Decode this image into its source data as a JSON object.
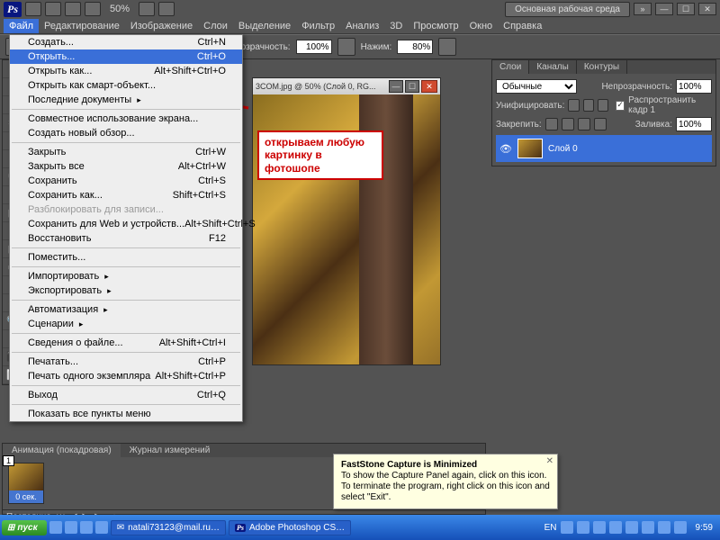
{
  "app_badge": "Ps",
  "zoom_title": "50%",
  "workspace_label": "Основная рабочая среда",
  "menubar": [
    "Файл",
    "Редактирование",
    "Изображение",
    "Слои",
    "Выделение",
    "Фильтр",
    "Анализ",
    "3D",
    "Просмотр",
    "Окно",
    "Справка"
  ],
  "options": {
    "label1": "Непрозрачность:",
    "val1": "100%",
    "label2": "Нажим:",
    "val2": "80%"
  },
  "file_menu": [
    {
      "label": "Создать...",
      "short": "Ctrl+N",
      "type": "i"
    },
    {
      "label": "Открыть...",
      "short": "Ctrl+O",
      "type": "hover"
    },
    {
      "label": "Открыть как...",
      "short": "Alt+Shift+Ctrl+O",
      "type": "i"
    },
    {
      "label": "Открыть как смарт-объект...",
      "short": "",
      "type": "i"
    },
    {
      "label": "Последние документы",
      "short": "",
      "type": "sub"
    },
    {
      "type": "sep"
    },
    {
      "label": "Совместное использование экрана...",
      "short": "",
      "type": "i"
    },
    {
      "label": "Создать новый обзор...",
      "short": "",
      "type": "i"
    },
    {
      "type": "sep"
    },
    {
      "label": "Закрыть",
      "short": "Ctrl+W",
      "type": "i"
    },
    {
      "label": "Закрыть все",
      "short": "Alt+Ctrl+W",
      "type": "i"
    },
    {
      "label": "Сохранить",
      "short": "Ctrl+S",
      "type": "i"
    },
    {
      "label": "Сохранить как...",
      "short": "Shift+Ctrl+S",
      "type": "i"
    },
    {
      "label": "Разблокировать для записи...",
      "short": "",
      "type": "disabled"
    },
    {
      "label": "Сохранить для Web и устройств...",
      "short": "Alt+Shift+Ctrl+S",
      "type": "i"
    },
    {
      "label": "Восстановить",
      "short": "F12",
      "type": "i"
    },
    {
      "type": "sep"
    },
    {
      "label": "Поместить...",
      "short": "",
      "type": "i"
    },
    {
      "type": "sep"
    },
    {
      "label": "Импортировать",
      "short": "",
      "type": "sub"
    },
    {
      "label": "Экспортировать",
      "short": "",
      "type": "sub"
    },
    {
      "type": "sep"
    },
    {
      "label": "Автоматизация",
      "short": "",
      "type": "sub"
    },
    {
      "label": "Сценарии",
      "short": "",
      "type": "sub"
    },
    {
      "type": "sep"
    },
    {
      "label": "Сведения о файле...",
      "short": "Alt+Shift+Ctrl+I",
      "type": "i"
    },
    {
      "type": "sep"
    },
    {
      "label": "Печатать...",
      "short": "Ctrl+P",
      "type": "i"
    },
    {
      "label": "Печать одного экземпляра",
      "short": "Alt+Shift+Ctrl+P",
      "type": "i"
    },
    {
      "type": "sep"
    },
    {
      "label": "Выход",
      "short": "Ctrl+Q",
      "type": "i"
    },
    {
      "type": "sep"
    },
    {
      "label": "Показать все пункты меню",
      "short": "",
      "type": "i"
    }
  ],
  "doc_title": "3COM.jpg @ 50% (Слой 0, RG...",
  "annotation": "открываем любую картинку в фотошопе",
  "layers_tabs": [
    "Слои",
    "Каналы",
    "Контуры"
  ],
  "layers": {
    "mode": "Обычные",
    "opacity_label": "Непрозрачность:",
    "opacity": "100%",
    "unify": "Унифицировать:",
    "propagate": "Распространить кадр 1",
    "lock": "Закрепить:",
    "fill_label": "Заливка:",
    "fill": "100%",
    "layer_name": "Слой 0"
  },
  "anim_tabs": [
    "Анимация (покадровая)",
    "Журнал измерений"
  ],
  "frame": {
    "num": "1",
    "time": "0 сек."
  },
  "anim_footer": "Постоянно",
  "tooltip": {
    "title": "FastStone Capture is Minimized",
    "body": "To show the Capture Panel again, click on this icon.\nTo terminate the program, right click on this icon and select \"Exit\"."
  },
  "taskbar": {
    "start": "пуск",
    "app1": "natali73123@mail.ru…",
    "app2": "Adobe Photoshop CS…",
    "lang": "EN",
    "clock": "9:59"
  }
}
